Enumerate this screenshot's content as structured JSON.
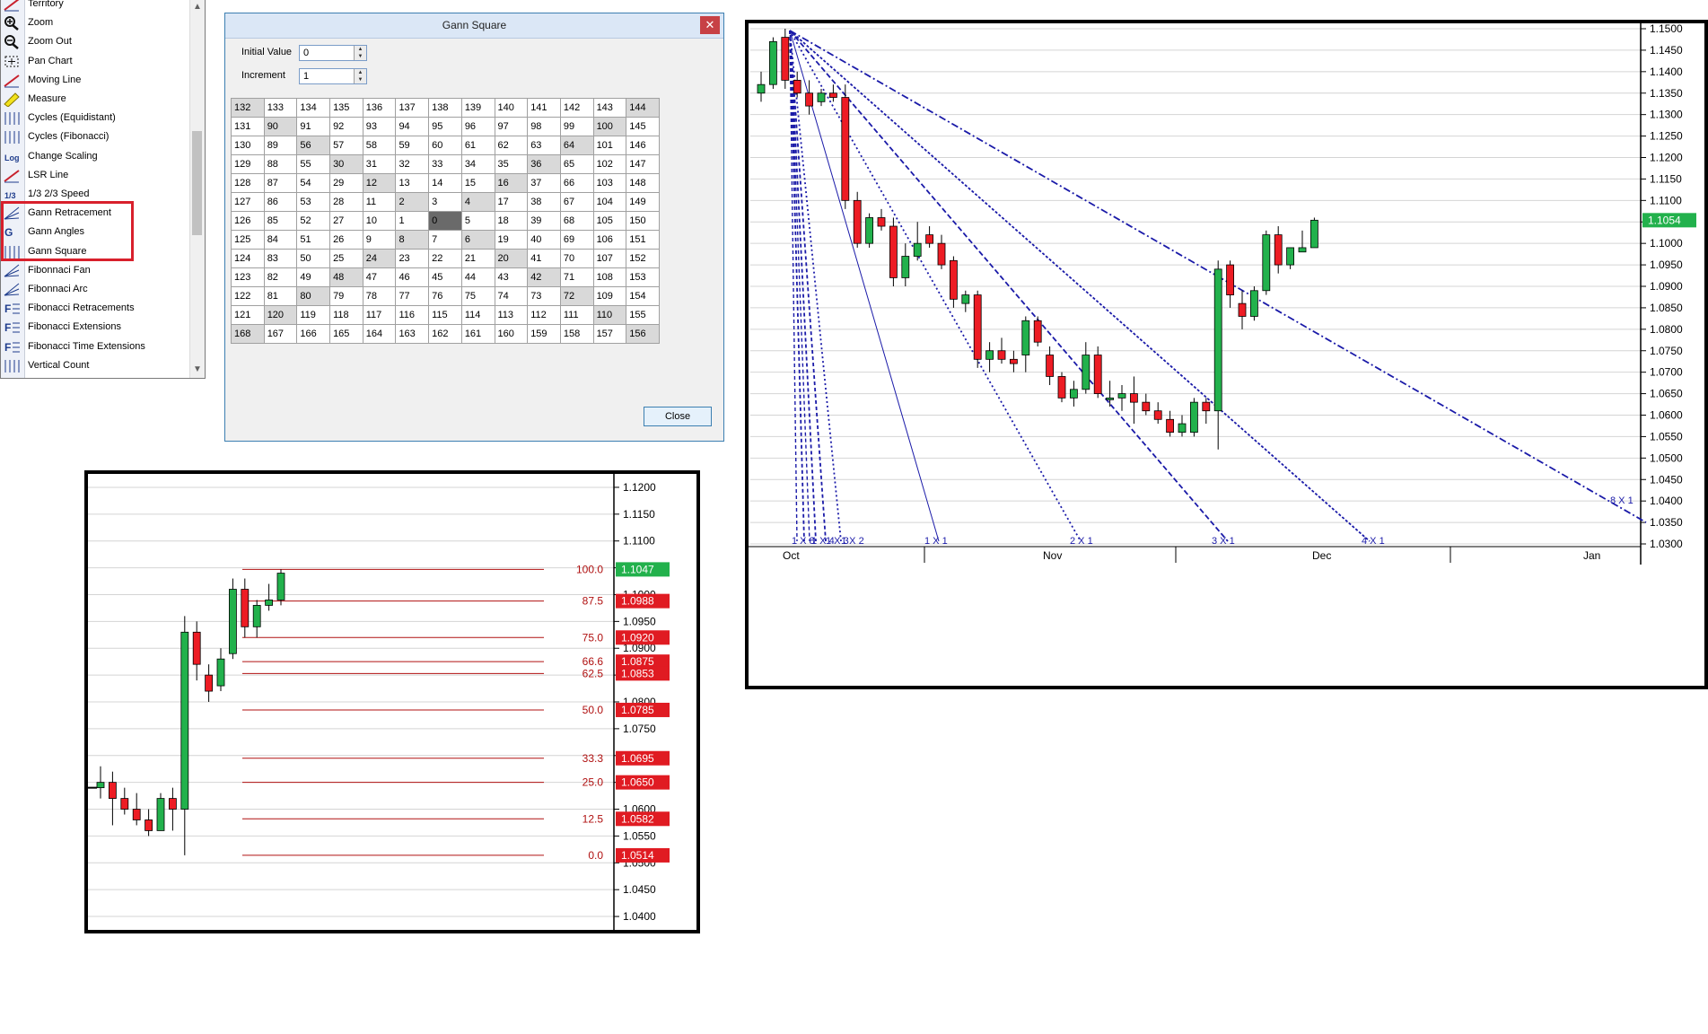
{
  "tools_panel": {
    "items": [
      {
        "label": "Territory",
        "icon": "territory-icon"
      },
      {
        "label": "Zoom",
        "icon": "zoom-in-icon"
      },
      {
        "label": "Zoom Out",
        "icon": "zoom-out-icon"
      },
      {
        "label": "Pan Chart",
        "icon": "pan-icon"
      },
      {
        "label": "Moving Line",
        "icon": "moving-line-icon"
      },
      {
        "label": "Measure",
        "icon": "ruler-icon"
      },
      {
        "label": "Cycles (Equidistant)",
        "icon": "cycles-equidistant-icon"
      },
      {
        "label": "Cycles (Fibonacci)",
        "icon": "cycles-fibonacci-icon"
      },
      {
        "label": "Change Scaling",
        "icon": "log-scale-icon",
        "glyph": "Log"
      },
      {
        "label": "LSR Line",
        "icon": "lsr-line-icon"
      },
      {
        "label": "1/3 2/3 Speed",
        "icon": "speed-lines-icon",
        "glyph": "1/3"
      },
      {
        "label": "Gann Retracement",
        "icon": "gann-retracement-icon"
      },
      {
        "label": "Gann Angles",
        "icon": "gann-angles-icon",
        "glyph": "G"
      },
      {
        "label": "Gann Square",
        "icon": "gann-square-icon"
      },
      {
        "label": "Fibonnaci Fan",
        "icon": "fibonacci-fan-icon"
      },
      {
        "label": "Fibonnaci Arc",
        "icon": "fibonacci-arc-icon"
      },
      {
        "label": "Fibonacci Retracements",
        "icon": "fibonacci-retracements-icon",
        "glyph": "F"
      },
      {
        "label": "Fibonacci Extensions",
        "icon": "fibonacci-extensions-icon",
        "glyph": "F"
      },
      {
        "label": "Fibonacci Time Extensions",
        "icon": "fibonacci-time-extensions-icon",
        "glyph": "F"
      },
      {
        "label": "Vertical Count",
        "icon": "vertical-count-icon"
      }
    ],
    "highlight_color": "#d8202c"
  },
  "dialog": {
    "title": "Gann Square",
    "close_glyph": "✕",
    "initial_value_label": "Initial Value",
    "initial_value": "0",
    "increment_label": "Increment",
    "increment": "1",
    "close_button": "Close",
    "grid": [
      [
        "132",
        "133",
        "134",
        "135",
        "136",
        "137",
        "138",
        "139",
        "140",
        "141",
        "142",
        "143",
        "144"
      ],
      [
        "131",
        "90",
        "91",
        "92",
        "93",
        "94",
        "95",
        "96",
        "97",
        "98",
        "99",
        "100",
        "145"
      ],
      [
        "130",
        "89",
        "56",
        "57",
        "58",
        "59",
        "60",
        "61",
        "62",
        "63",
        "64",
        "101",
        "146"
      ],
      [
        "129",
        "88",
        "55",
        "30",
        "31",
        "32",
        "33",
        "34",
        "35",
        "36",
        "65",
        "102",
        "147"
      ],
      [
        "128",
        "87",
        "54",
        "29",
        "12",
        "13",
        "14",
        "15",
        "16",
        "37",
        "66",
        "103",
        "148"
      ],
      [
        "127",
        "86",
        "53",
        "28",
        "11",
        "2",
        "3",
        "4",
        "17",
        "38",
        "67",
        "104",
        "149"
      ],
      [
        "126",
        "85",
        "52",
        "27",
        "10",
        "1",
        "0",
        "5",
        "18",
        "39",
        "68",
        "105",
        "150"
      ],
      [
        "125",
        "84",
        "51",
        "26",
        "9",
        "8",
        "7",
        "6",
        "19",
        "40",
        "69",
        "106",
        "151"
      ],
      [
        "124",
        "83",
        "50",
        "25",
        "24",
        "23",
        "22",
        "21",
        "20",
        "41",
        "70",
        "107",
        "152"
      ],
      [
        "123",
        "82",
        "49",
        "48",
        "47",
        "46",
        "45",
        "44",
        "43",
        "42",
        "71",
        "108",
        "153"
      ],
      [
        "122",
        "81",
        "80",
        "79",
        "78",
        "77",
        "76",
        "75",
        "74",
        "73",
        "72",
        "109",
        "154"
      ],
      [
        "121",
        "120",
        "119",
        "118",
        "117",
        "116",
        "115",
        "114",
        "113",
        "112",
        "111",
        "110",
        "155"
      ],
      [
        "168",
        "167",
        "166",
        "165",
        "164",
        "163",
        "162",
        "161",
        "160",
        "159",
        "158",
        "157",
        "156"
      ]
    ]
  },
  "chart_data": [
    {
      "type": "candlestick",
      "name": "gann-angles-chart",
      "y_ticks": [
        "1.1500",
        "1.1450",
        "1.1400",
        "1.1350",
        "1.1300",
        "1.1250",
        "1.1200",
        "1.1150",
        "1.1100",
        "1.1050",
        "1.1000",
        "1.0950",
        "1.0900",
        "1.0850",
        "1.0800",
        "1.0750",
        "1.0700",
        "1.0650",
        "1.0600",
        "1.0550",
        "1.0500",
        "1.0450",
        "1.0400",
        "1.0350",
        "1.0300"
      ],
      "ylim": [
        1.03,
        1.15
      ],
      "x_labels": [
        "Oct",
        "Nov",
        "Dec",
        "Jan"
      ],
      "current_price": "1.1054",
      "gann_labels": [
        "1 X 8",
        "1 X 4",
        "1 X 3",
        "1 X 2",
        "1 X 1",
        "2 X 1",
        "3 X 1",
        "4 X 1",
        "8 X 1"
      ],
      "bull_color": "#22b14c",
      "bear_color": "#ed1c24",
      "line_color": "#1a1aa8",
      "candles": [
        {
          "o": 1.135,
          "h": 1.14,
          "l": 1.133,
          "c": 1.137
        },
        {
          "o": 1.137,
          "h": 1.148,
          "l": 1.136,
          "c": 1.147
        },
        {
          "o": 1.148,
          "h": 1.15,
          "l": 1.136,
          "c": 1.138
        },
        {
          "o": 1.138,
          "h": 1.14,
          "l": 1.134,
          "c": 1.135
        },
        {
          "o": 1.135,
          "h": 1.138,
          "l": 1.13,
          "c": 1.132
        },
        {
          "o": 1.133,
          "h": 1.136,
          "l": 1.132,
          "c": 1.135
        },
        {
          "o": 1.135,
          "h": 1.137,
          "l": 1.133,
          "c": 1.134
        },
        {
          "o": 1.134,
          "h": 1.137,
          "l": 1.108,
          "c": 1.11
        },
        {
          "o": 1.11,
          "h": 1.112,
          "l": 1.099,
          "c": 1.1
        },
        {
          "o": 1.1,
          "h": 1.107,
          "l": 1.099,
          "c": 1.106
        },
        {
          "o": 1.106,
          "h": 1.108,
          "l": 1.103,
          "c": 1.104
        },
        {
          "o": 1.104,
          "h": 1.106,
          "l": 1.09,
          "c": 1.092
        },
        {
          "o": 1.092,
          "h": 1.1,
          "l": 1.09,
          "c": 1.097
        },
        {
          "o": 1.097,
          "h": 1.105,
          "l": 1.096,
          "c": 1.1
        },
        {
          "o": 1.102,
          "h": 1.104,
          "l": 1.099,
          "c": 1.1
        },
        {
          "o": 1.1,
          "h": 1.102,
          "l": 1.094,
          "c": 1.095
        },
        {
          "o": 1.096,
          "h": 1.097,
          "l": 1.085,
          "c": 1.087
        },
        {
          "o": 1.086,
          "h": 1.089,
          "l": 1.084,
          "c": 1.088
        },
        {
          "o": 1.088,
          "h": 1.089,
          "l": 1.071,
          "c": 1.073
        },
        {
          "o": 1.073,
          "h": 1.077,
          "l": 1.07,
          "c": 1.075
        },
        {
          "o": 1.075,
          "h": 1.078,
          "l": 1.072,
          "c": 1.073
        },
        {
          "o": 1.073,
          "h": 1.075,
          "l": 1.07,
          "c": 1.072
        },
        {
          "o": 1.074,
          "h": 1.083,
          "l": 1.07,
          "c": 1.082
        },
        {
          "o": 1.082,
          "h": 1.083,
          "l": 1.076,
          "c": 1.077
        },
        {
          "o": 1.074,
          "h": 1.076,
          "l": 1.067,
          "c": 1.069
        },
        {
          "o": 1.069,
          "h": 1.07,
          "l": 1.063,
          "c": 1.064
        },
        {
          "o": 1.064,
          "h": 1.068,
          "l": 1.062,
          "c": 1.066
        },
        {
          "o": 1.066,
          "h": 1.077,
          "l": 1.065,
          "c": 1.074
        },
        {
          "o": 1.074,
          "h": 1.076,
          "l": 1.064,
          "c": 1.065
        },
        {
          "o": 1.064,
          "h": 1.068,
          "l": 1.062,
          "c": 1.064
        },
        {
          "o": 1.064,
          "h": 1.067,
          "l": 1.061,
          "c": 1.065
        },
        {
          "o": 1.065,
          "h": 1.069,
          "l": 1.058,
          "c": 1.063
        },
        {
          "o": 1.063,
          "h": 1.065,
          "l": 1.06,
          "c": 1.061
        },
        {
          "o": 1.061,
          "h": 1.063,
          "l": 1.058,
          "c": 1.059
        },
        {
          "o": 1.059,
          "h": 1.061,
          "l": 1.055,
          "c": 1.056
        },
        {
          "o": 1.056,
          "h": 1.06,
          "l": 1.055,
          "c": 1.058
        },
        {
          "o": 1.056,
          "h": 1.064,
          "l": 1.055,
          "c": 1.063
        },
        {
          "o": 1.063,
          "h": 1.064,
          "l": 1.058,
          "c": 1.061
        },
        {
          "o": 1.061,
          "h": 1.096,
          "l": 1.052,
          "c": 1.094
        },
        {
          "o": 1.095,
          "h": 1.096,
          "l": 1.085,
          "c": 1.088
        },
        {
          "o": 1.086,
          "h": 1.089,
          "l": 1.08,
          "c": 1.083
        },
        {
          "o": 1.083,
          "h": 1.09,
          "l": 1.082,
          "c": 1.089
        },
        {
          "o": 1.089,
          "h": 1.103,
          "l": 1.088,
          "c": 1.102
        },
        {
          "o": 1.102,
          "h": 1.104,
          "l": 1.093,
          "c": 1.095
        },
        {
          "o": 1.095,
          "h": 1.099,
          "l": 1.094,
          "c": 1.099
        },
        {
          "o": 1.098,
          "h": 1.103,
          "l": 1.098,
          "c": 1.099
        },
        {
          "o": 1.099,
          "h": 1.106,
          "l": 1.099,
          "c": 1.1054
        }
      ]
    },
    {
      "type": "candlestick",
      "name": "gann-retracement-chart",
      "y_ticks": [
        "1.1200",
        "1.1150",
        "1.1100",
        "1.1050",
        "1.1000",
        "1.0950",
        "1.0900",
        "1.0850",
        "1.0800",
        "1.0750",
        "1.0700",
        "1.0650",
        "1.0600",
        "1.0550",
        "1.0500",
        "1.0450",
        "1.0400"
      ],
      "ylim": [
        1.0375,
        1.1225
      ],
      "levels": [
        {
          "label": "100.0",
          "price": "1.1047",
          "value": 1.1047
        },
        {
          "label": "87.5",
          "price": "1.0988",
          "value": 1.0988
        },
        {
          "label": "75.0",
          "price": "1.0920",
          "value": 1.092
        },
        {
          "label": "66.6",
          "price": "1.0875",
          "value": 1.0875
        },
        {
          "label": "62.5",
          "price": "1.0853",
          "value": 1.0853
        },
        {
          "label": "50.0",
          "price": "1.0785",
          "value": 1.0785
        },
        {
          "label": "33.3",
          "price": "1.0695",
          "value": 1.0695
        },
        {
          "label": "25.0",
          "price": "1.0650",
          "value": 1.065
        },
        {
          "label": "12.5",
          "price": "1.0582",
          "value": 1.0582
        },
        {
          "label": "0.0",
          "price": "1.0514",
          "value": 1.0514
        }
      ],
      "candles": [
        {
          "o": 1.064,
          "h": 1.068,
          "l": 1.062,
          "c": 1.065
        },
        {
          "o": 1.065,
          "h": 1.067,
          "l": 1.057,
          "c": 1.062
        },
        {
          "o": 1.062,
          "h": 1.064,
          "l": 1.059,
          "c": 1.06
        },
        {
          "o": 1.06,
          "h": 1.063,
          "l": 1.057,
          "c": 1.058
        },
        {
          "o": 1.058,
          "h": 1.06,
          "l": 1.055,
          "c": 1.056
        },
        {
          "o": 1.056,
          "h": 1.063,
          "l": 1.056,
          "c": 1.062
        },
        {
          "o": 1.062,
          "h": 1.064,
          "l": 1.056,
          "c": 1.06
        },
        {
          "o": 1.06,
          "h": 1.096,
          "l": 1.0514,
          "c": 1.093
        },
        {
          "o": 1.093,
          "h": 1.095,
          "l": 1.084,
          "c": 1.087
        },
        {
          "o": 1.085,
          "h": 1.087,
          "l": 1.08,
          "c": 1.082
        },
        {
          "o": 1.083,
          "h": 1.09,
          "l": 1.082,
          "c": 1.088
        },
        {
          "o": 1.089,
          "h": 1.103,
          "l": 1.088,
          "c": 1.101
        },
        {
          "o": 1.101,
          "h": 1.103,
          "l": 1.092,
          "c": 1.094
        },
        {
          "o": 1.094,
          "h": 1.099,
          "l": 1.092,
          "c": 1.098
        },
        {
          "o": 1.098,
          "h": 1.102,
          "l": 1.097,
          "c": 1.099
        },
        {
          "o": 1.099,
          "h": 1.1047,
          "l": 1.098,
          "c": 1.104
        }
      ]
    }
  ]
}
